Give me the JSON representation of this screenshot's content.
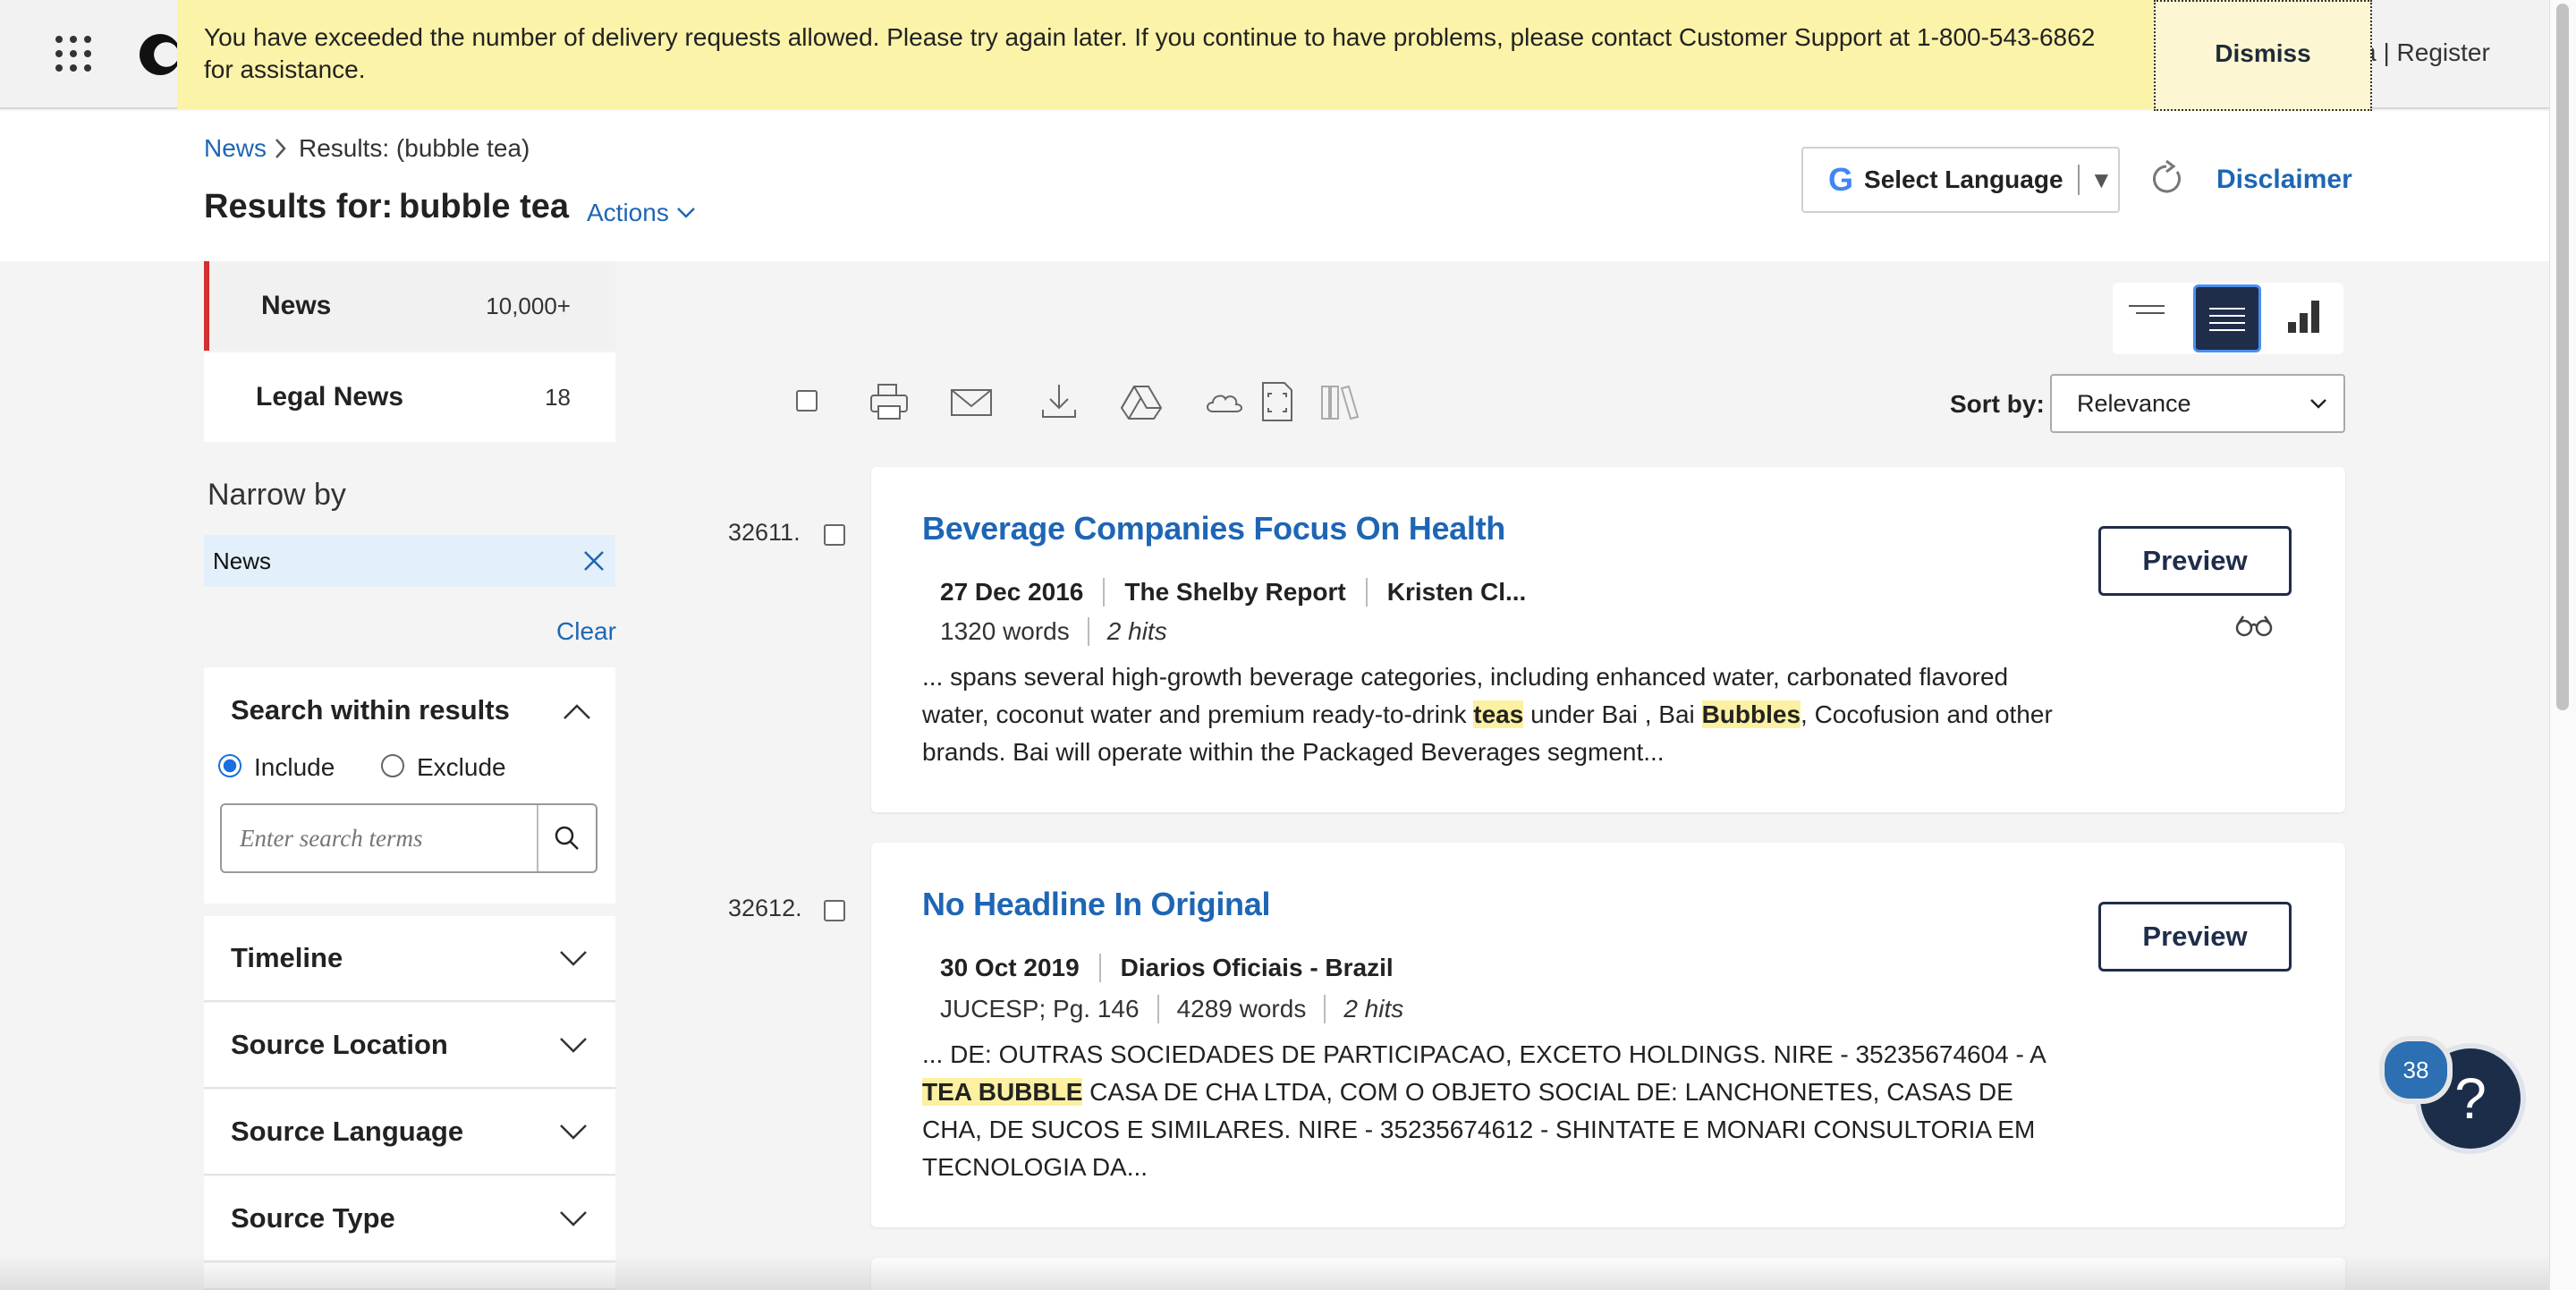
{
  "topbar": {
    "signin_fragment": "a",
    "register": "| Register"
  },
  "banner": {
    "message": "You have exceeded the number of delivery requests allowed. Please try again later. If you continue to have problems, please contact Customer Support at 1-800-543-6862 for assistance.",
    "dismiss_label": "Dismiss"
  },
  "breadcrumb": {
    "root": "News",
    "current": "Results: (bubble tea)"
  },
  "results": {
    "prefix": "Results for:",
    "term": "bubble tea",
    "actions_label": "Actions"
  },
  "language": {
    "google_g": "G",
    "label": "Select Language",
    "arrow": "▼"
  },
  "disclaimer_label": "Disclaimer",
  "sidebar": {
    "tabs": [
      {
        "name": "News",
        "count": "10,000+"
      },
      {
        "name": "Legal News",
        "count": "18"
      }
    ],
    "narrow_by": "Narrow by",
    "chip": "News",
    "clear_label": "Clear",
    "search_within": {
      "title": "Search within results",
      "include": "Include",
      "exclude": "Exclude",
      "placeholder": "Enter search terms"
    },
    "accordions": [
      "Timeline",
      "Source Location",
      "Source Language",
      "Source Type"
    ]
  },
  "sort": {
    "label": "Sort by:",
    "selected": "Relevance"
  },
  "results_list": [
    {
      "num": "32611.",
      "headline": "Beverage Companies Focus On Health",
      "date": "27 Dec 2016",
      "source": "The Shelby Report",
      "author": "Kristen Cl...",
      "words": "1320 words",
      "hits": "2 hits",
      "snippet_a": "... spans several high-growth beverage categories, including enhanced water, carbonated flavored water, coconut water and premium ready-to-drink ",
      "hl_a": "teas",
      "snippet_b": " under Bai , Bai ",
      "hl_b": "Bubbles",
      "snippet_c": ", Cocofusion and other brands. Bai will operate within the Packaged Beverages segment...",
      "preview_label": "Preview"
    },
    {
      "num": "32612.",
      "headline": "No Headline In Original",
      "date": "30 Oct 2019",
      "source": "Diarios Oficiais - Brazil",
      "page": "JUCESP; Pg. 146",
      "words": "4289 words",
      "hits": "2 hits",
      "snippet_a": "... DE: OUTRAS SOCIEDADES DE PARTICIPACAO, EXCETO HOLDINGS. NIRE - 35235674604 - A ",
      "hl_a": "TEA BUBBLE",
      "snippet_b": " CASA DE CHA LTDA, COM O OBJETO SOCIAL DE: LANCHONETES, CASAS DE CHA, DE SUCOS E SIMILARES. NIRE - 35235674612 - SHINTATE E MONARI CONSULTORIA EM TECNOLOGIA DA...",
      "preview_label": "Preview"
    }
  ],
  "help": {
    "badge": "38",
    "glyph": "?"
  }
}
